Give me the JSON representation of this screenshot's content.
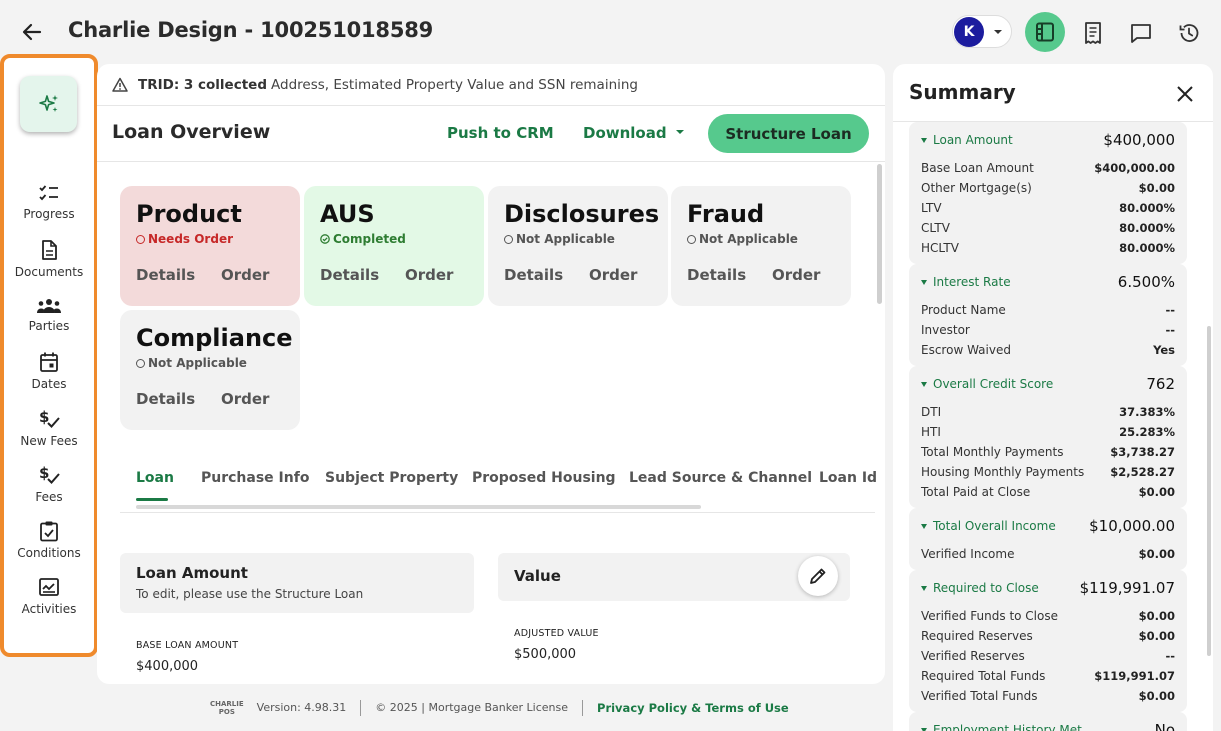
{
  "header": {
    "title": "Charlie Design - 100251018589",
    "avatar_initial": "K"
  },
  "rail": [
    {
      "label": "Progress",
      "icon": "checklist-icon"
    },
    {
      "label": "Documents",
      "icon": "document-icon"
    },
    {
      "label": "Parties",
      "icon": "people-icon"
    },
    {
      "label": "Dates",
      "icon": "calendar-icon"
    },
    {
      "label": "New Fees",
      "icon": "dollar-check-icon"
    },
    {
      "label": "Fees",
      "icon": "dollar-check-icon"
    },
    {
      "label": "Conditions",
      "icon": "clipboard-check-icon"
    },
    {
      "label": "Activities",
      "icon": "activity-icon"
    }
  ],
  "trid": {
    "prefix": "TRID: 3 collected",
    "rest": "Address, Estimated Property Value and SSN remaining"
  },
  "overview": {
    "title": "Loan Overview",
    "push_label": "Push to CRM",
    "download_label": "Download",
    "structure_label": "Structure Loan",
    "cards": [
      {
        "title": "Product",
        "status": "Needs Order",
        "details": "Details",
        "order": "Order",
        "bg": "#f3dada",
        "status_color": "#c62828"
      },
      {
        "title": "AUS",
        "status": "Completed",
        "details": "Details",
        "order": "Order",
        "bg": "#e3f9e6",
        "status_color": "#2e7d32"
      },
      {
        "title": "Disclosures",
        "status": "Not Applicable",
        "details": "Details",
        "order": "Order",
        "bg": "#f2f2f2",
        "status_color": "#555555"
      },
      {
        "title": "Fraud",
        "status": "Not Applicable",
        "details": "Details",
        "order": "Order",
        "bg": "#f2f2f2",
        "status_color": "#555555"
      },
      {
        "title": "Compliance",
        "status": "Not Applicable",
        "details": "Details",
        "order": "Order",
        "bg": "#f2f2f2",
        "status_color": "#555555"
      }
    ]
  },
  "tabs": [
    "Loan",
    "Purchase Info",
    "Subject Property",
    "Proposed Housing",
    "Lead Source & Channel",
    "Loan Ide"
  ],
  "loan_amount": {
    "title": "Loan Amount",
    "subtitle": "To edit, please use the Structure Loan",
    "base_label": "BASE LOAN AMOUNT",
    "base_value": "$400,000"
  },
  "value": {
    "title": "Value",
    "adjusted_label": "ADJUSTED VALUE",
    "adjusted_value": "$500,000"
  },
  "footer": {
    "logo_top": "CHARLIE",
    "logo_bottom": "POS",
    "version": "Version: 4.98.31",
    "copyright": "© 2025 | Mortgage Banker License",
    "privacy": "Privacy Policy & Terms of Use"
  },
  "summary": {
    "title": "Summary",
    "sections": [
      {
        "name": "Loan Amount",
        "value": "$400,000",
        "rows": [
          {
            "label": "Base Loan Amount",
            "value": "$400,000.00"
          },
          {
            "label": "Other Mortgage(s)",
            "value": "$0.00"
          },
          {
            "label": "LTV",
            "value": "80.000%"
          },
          {
            "label": "CLTV",
            "value": "80.000%"
          },
          {
            "label": "HCLTV",
            "value": "80.000%"
          }
        ]
      },
      {
        "name": "Interest Rate",
        "value": "6.500%",
        "rows": [
          {
            "label": "Product Name",
            "value": "--"
          },
          {
            "label": "Investor",
            "value": "--"
          },
          {
            "label": "Escrow Waived",
            "value": "Yes"
          }
        ]
      },
      {
        "name": "Overall Credit Score",
        "value": "762",
        "rows": [
          {
            "label": "DTI",
            "value": "37.383%"
          },
          {
            "label": "HTI",
            "value": "25.283%"
          },
          {
            "label": "Total Monthly Payments",
            "value": "$3,738.27"
          },
          {
            "label": "Housing Monthly Payments",
            "value": "$2,528.27"
          },
          {
            "label": "Total Paid at Close",
            "value": "$0.00"
          }
        ]
      },
      {
        "name": "Total Overall Income",
        "value": "$10,000.00",
        "rows": [
          {
            "label": "Verified Income",
            "value": "$0.00"
          }
        ]
      },
      {
        "name": "Required to Close",
        "value": "$119,991.07",
        "rows": [
          {
            "label": "Verified Funds to Close",
            "value": "$0.00"
          },
          {
            "label": "Required Reserves",
            "value": "$0.00"
          },
          {
            "label": "Verified Reserves",
            "value": "--"
          },
          {
            "label": "Required Total Funds",
            "value": "$119,991.07"
          },
          {
            "label": "Verified Total Funds",
            "value": "$0.00"
          }
        ]
      },
      {
        "name": "Employment History Met",
        "value": "No",
        "rows": []
      }
    ]
  }
}
